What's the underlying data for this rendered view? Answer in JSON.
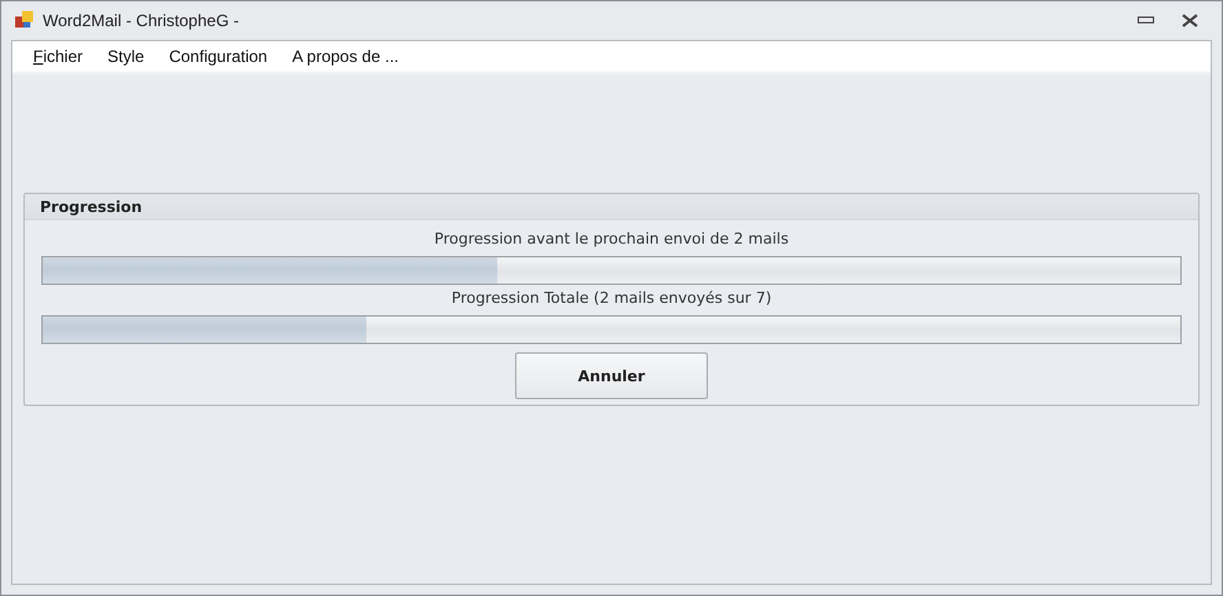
{
  "window": {
    "title": "Word2Mail - ChristopheG -"
  },
  "menu": [
    {
      "label": "Fichier",
      "first_letter_underlined": true
    },
    {
      "label": "Style"
    },
    {
      "label": "Configuration"
    },
    {
      "label": "A propos de ..."
    }
  ],
  "group": {
    "title": "Progression",
    "bars": [
      {
        "caption": "Progression avant le prochain envoi de 2 mails",
        "level": 0.4
      },
      {
        "caption": "Progression Totale (2 mails envoyés sur 7)",
        "level": 0.285
      }
    ],
    "button": "Annuler"
  }
}
